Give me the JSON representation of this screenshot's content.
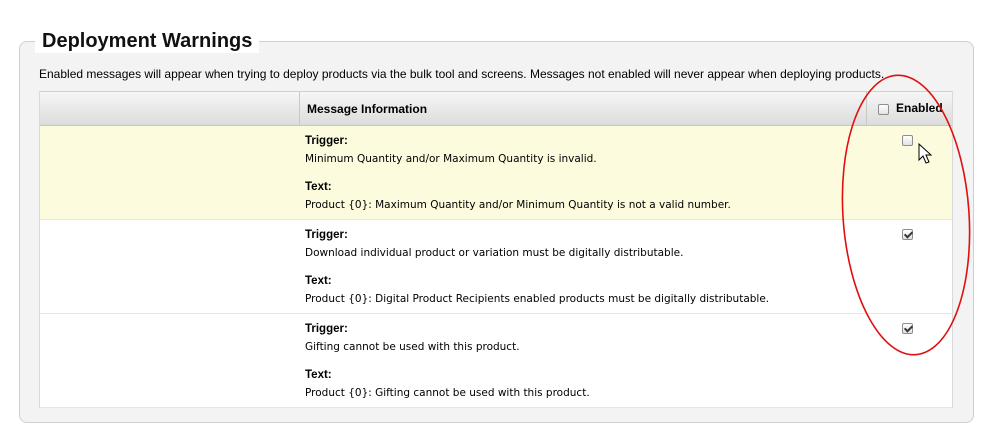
{
  "section": {
    "title": "Deployment Warnings",
    "description": "Enabled messages will appear when trying to deploy products via the bulk tool and screens. Messages not enabled will never appear when deploying products."
  },
  "table": {
    "columns": {
      "message_info": "Message Information",
      "enabled": "Enabled"
    },
    "rows": [
      {
        "trigger_label": "Trigger:",
        "trigger": "Minimum Quantity and/or Maximum Quantity is invalid.",
        "text_label": "Text:",
        "text": "Product {0}: Maximum Quantity and/or Minimum Quantity is not a valid number.",
        "enabled": false
      },
      {
        "trigger_label": "Trigger:",
        "trigger": "Download individual product or variation must be digitally distributable.",
        "text_label": "Text:",
        "text": "Product {0}: Digital Product Recipients enabled products must be digitally distributable.",
        "enabled": true
      },
      {
        "trigger_label": "Trigger:",
        "trigger": "Gifting cannot be used with this product.",
        "text_label": "Text:",
        "text": "Product {0}: Gifting cannot be used with this product.",
        "enabled": true
      }
    ]
  },
  "colors": {
    "highlight_row": "#fdfbdd",
    "annotation_ring": "#e01010"
  }
}
